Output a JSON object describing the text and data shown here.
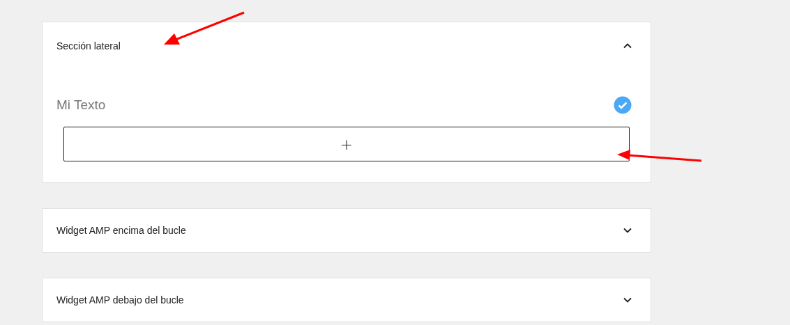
{
  "panels": [
    {
      "title": "Sección lateral",
      "expanded": true,
      "widget_title": "Mi Texto",
      "add_symbol": "+"
    },
    {
      "title": "Widget AMP encima del bucle",
      "expanded": false
    },
    {
      "title": "Widget AMP debajo del bucle",
      "expanded": false
    }
  ]
}
